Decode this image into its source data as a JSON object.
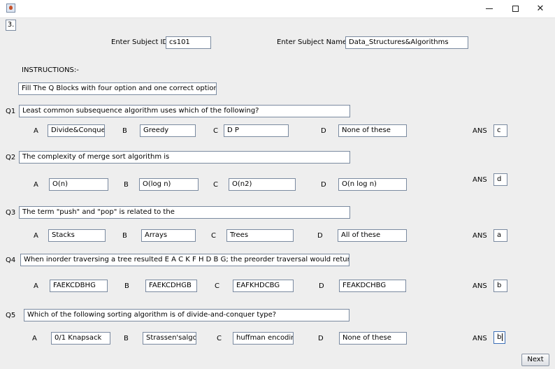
{
  "window": {
    "icon": "java-icon",
    "minimize_label": "",
    "maximize_label": "",
    "close_label": "✕"
  },
  "question_number": "3.",
  "subject": {
    "id_label": "Enter Subject ID",
    "id_value": "cs101",
    "name_label": "Enter Subject Name",
    "name_value": "Data_Structures&Algorithms"
  },
  "instructions": {
    "heading": "INSTRUCTIONS:-",
    "text": "Fill The Q Blocks with four option and one correct option"
  },
  "option_labels": [
    "A",
    "B",
    "C",
    "D"
  ],
  "ans_label": "ANS",
  "questions": [
    {
      "label": "Q1",
      "text": "Least common subsequence algorithm uses which of the following?",
      "options": [
        "Divide&Conquer",
        "Greedy",
        "D P",
        "None of these"
      ],
      "answer": "c"
    },
    {
      "label": "Q2",
      "text": "The complexity of merge sort algorithm is",
      "options": [
        "O(n)",
        "O(log n)",
        "O(n2)",
        "O(n log n)"
      ],
      "answer": "d"
    },
    {
      "label": "Q3",
      "text": "The term \"push\" and \"pop\" is related to the",
      "options": [
        "Stacks",
        "Arrays",
        "Trees",
        "All of these"
      ],
      "answer": "a"
    },
    {
      "label": "Q4",
      "text": "When inorder traversing a tree resulted E A C K F H D B G; the preorder traversal would return",
      "options": [
        "FAEKCDBHG",
        "FAEKCDHGB",
        "EAFKHDCBG",
        "FEAKDCHBG"
      ],
      "answer": "b"
    },
    {
      "label": "Q5",
      "text": "Which of the following sorting algorithm is of divide-and-conquer type?",
      "options": [
        "0/1 Knapsack",
        "Strassen'salgo",
        "huffman encoding",
        "None of these"
      ],
      "answer": "b"
    }
  ],
  "next_button": "Next"
}
